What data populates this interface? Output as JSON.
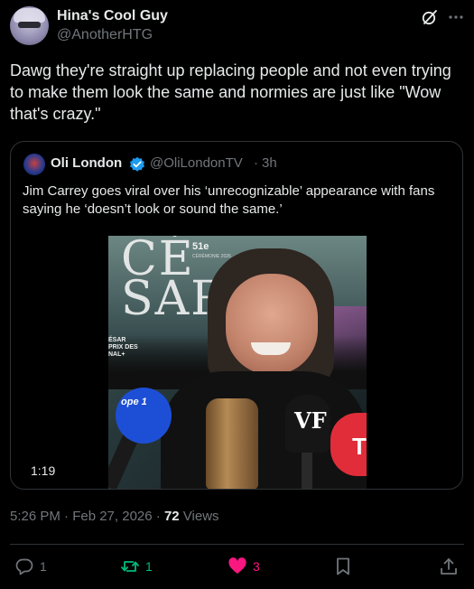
{
  "post": {
    "author": {
      "display_name": "Hina's Cool Guy",
      "handle": "@AnotherHTG"
    },
    "text": "Dawg they're straight up replacing people and not even trying to make them look the same and normies are just like \"Wow that's crazy.\"",
    "timestamp": "5:26 PM · Feb 27, 2026 ·",
    "views_count": "72",
    "views_label": "Views"
  },
  "quoted_post": {
    "author": {
      "display_name": "Oli London",
      "handle": "@OliLondonTV",
      "verified": true
    },
    "separator": "·",
    "time": "3h",
    "text": "Jim Carrey goes viral over his ‘unrecognizable’ appearance with fans saying he ‘doesn’t look or sound the same.’",
    "video": {
      "duration": "1:19",
      "overlay": {
        "cesar_line1": "CÉ",
        "cesar_line2": "SAR",
        "edition": "51e",
        "ceremony": "CÉRÉMONIE 2026",
        "left_sign": "ÉSAR\nPRIX DES\nNAL+",
        "mic_blue": "ope 1",
        "mic_black": "VF",
        "mic_red": "T"
      }
    }
  },
  "actions": {
    "reply_count": "1",
    "repost_count": "1",
    "like_count": "3"
  },
  "colors": {
    "background": "#000000",
    "text_primary": "#e7e9ea",
    "text_secondary": "#71767b",
    "border": "#2f3336",
    "verified": "#1d9bf0",
    "repost_active": "#00ba7c",
    "like_active": "#f91880"
  },
  "icons": {
    "grok": "grok-icon",
    "more": "more-icon",
    "verified": "verified-icon",
    "reply": "reply-icon",
    "repost": "repost-icon",
    "like": "heart-icon",
    "bookmark": "bookmark-icon",
    "share": "share-icon"
  }
}
